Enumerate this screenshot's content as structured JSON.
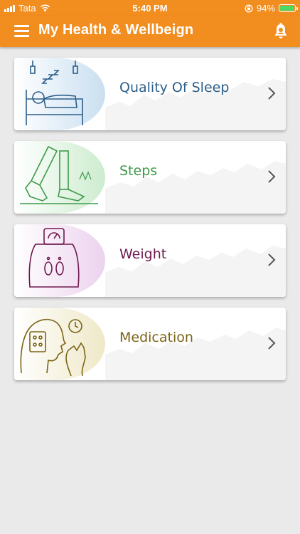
{
  "status_bar": {
    "carrier": "Tata",
    "time": "5:40 PM",
    "battery_percent": "94%",
    "battery_level": 0.94,
    "icons": [
      "signal-bars-icon",
      "wifi-icon",
      "orientation-lock-icon",
      "battery-icon"
    ]
  },
  "app_bar": {
    "title": "My Health & Wellbeign",
    "icons": [
      "hamburger-menu-icon",
      "notification-bell-icon"
    ]
  },
  "cards": [
    {
      "label": "Quality Of Sleep",
      "color": "#2c5f8a",
      "tint": "#c9dff0",
      "icon": "sleeping-person-icon"
    },
    {
      "label": "Steps",
      "color": "#3f9a4a",
      "tint": "#cdeccf",
      "icon": "walking-shoes-icon"
    },
    {
      "label": "Weight",
      "color": "#6e1a4e",
      "tint": "#ecd2ee",
      "icon": "weighing-scale-icon"
    },
    {
      "label": "Medication",
      "color": "#7a6416",
      "tint": "#efe8c8",
      "icon": "person-taking-pill-icon"
    }
  ],
  "colors": {
    "accent": "#f28d1f",
    "background": "#eaeaea"
  }
}
